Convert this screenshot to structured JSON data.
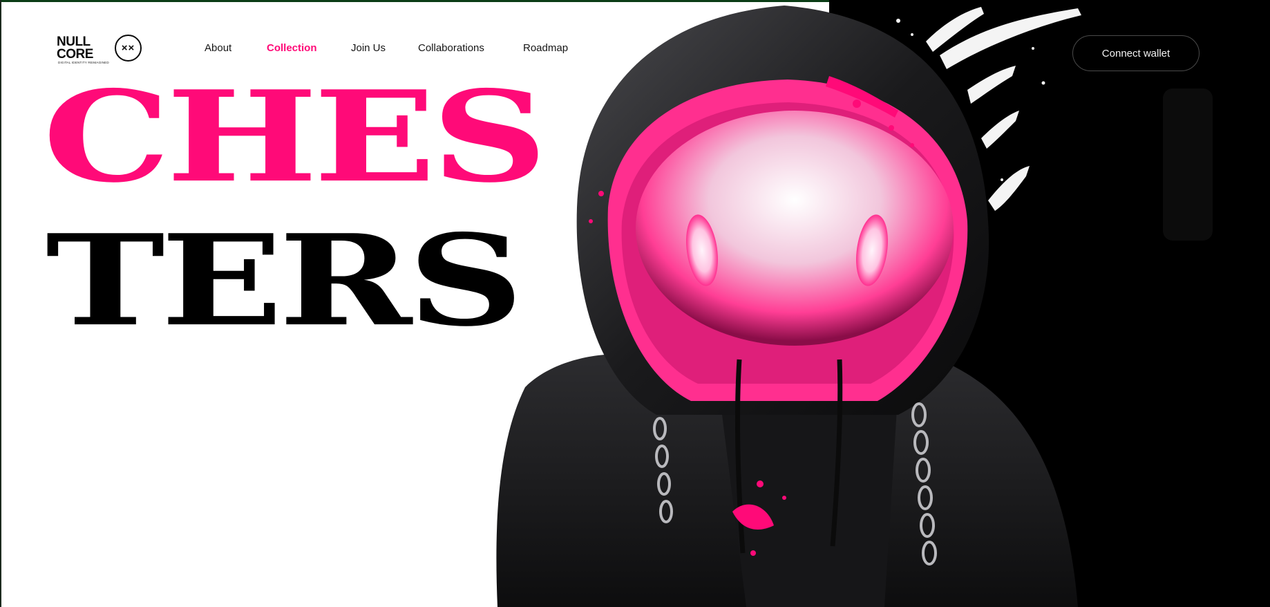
{
  "brand": {
    "logo_text_line1": "NULL",
    "logo_text_line2": "CORE",
    "logo_mark": "××",
    "tagline": "DIGITAL IDENTITY REIMAGINED"
  },
  "nav": {
    "items": [
      {
        "label": "About",
        "active": false
      },
      {
        "label": "Collection",
        "active": true
      },
      {
        "label": "Join Us",
        "active": false
      },
      {
        "label": "Collaborations",
        "active": false
      },
      {
        "label": "Roadmap",
        "active": false
      }
    ]
  },
  "header": {
    "cta_label": "Connect wallet"
  },
  "hero": {
    "title_line1": "CHES",
    "title_line2": "TERS"
  },
  "colors": {
    "accent": "#ff0a78",
    "text_dark": "#000000",
    "background": "#ffffff",
    "dark_panel": "#000000"
  },
  "icons": [
    "logo-mark-icon"
  ]
}
